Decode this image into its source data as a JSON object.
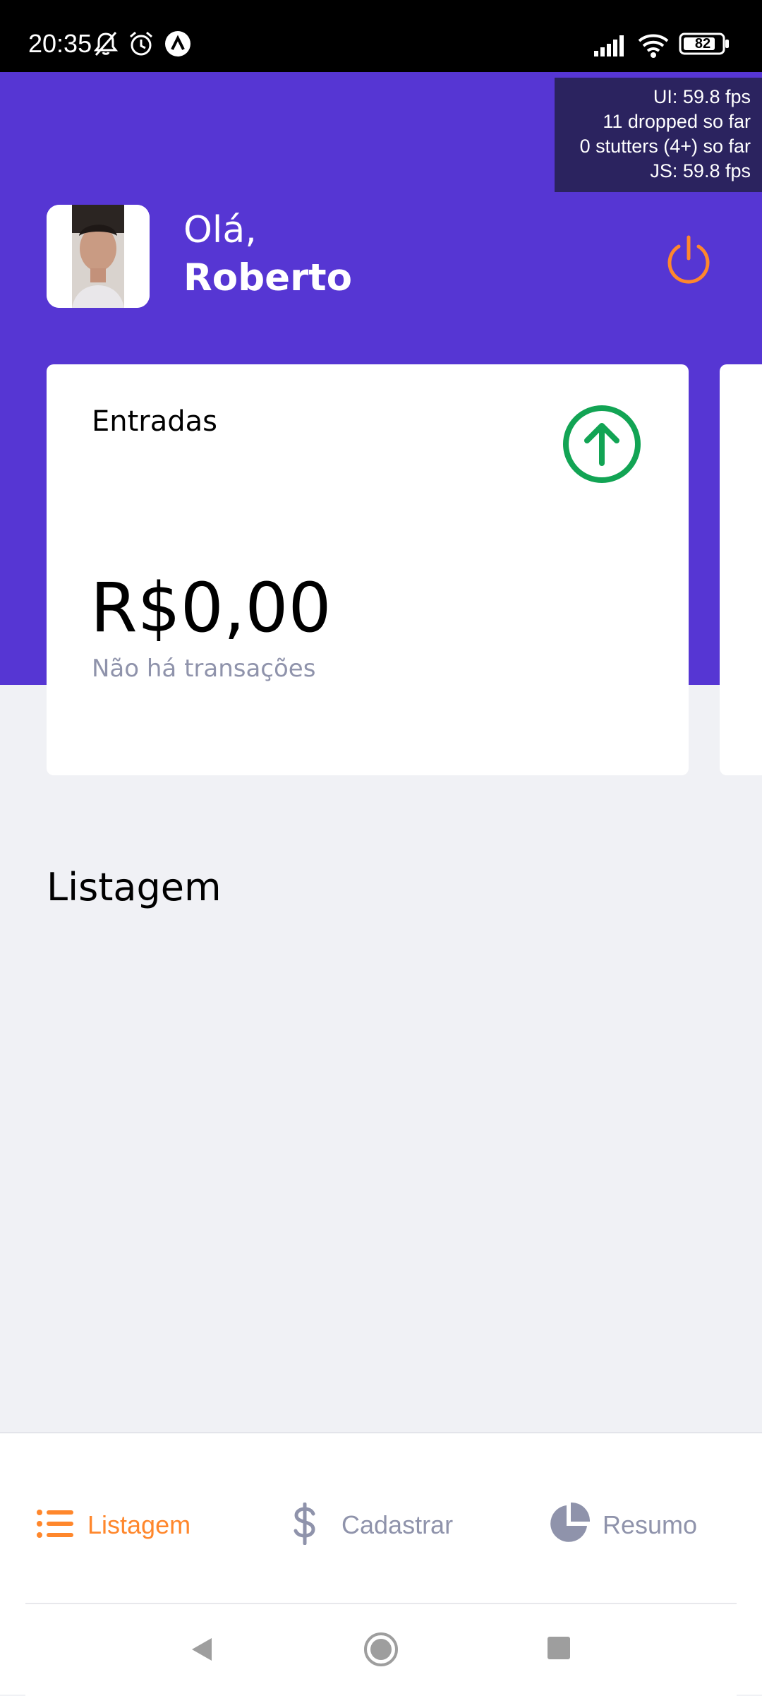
{
  "status_bar": {
    "time": "20:35",
    "battery": "82",
    "icons": [
      "mute-icon",
      "alarm-icon",
      "app-notification-icon",
      "signal-icon",
      "wifi-icon",
      "battery-icon"
    ]
  },
  "perf_monitor": {
    "ui_fps": "UI: 59.8 fps",
    "dropped": "11 dropped so far",
    "stutters": "0 stutters (4+) so far",
    "js_fps": "JS: 59.8 fps"
  },
  "header": {
    "greeting": "Olá,",
    "user_name": "Roberto",
    "logout_icon": "power-icon",
    "background_color": "#5636d3"
  },
  "summary_card": {
    "title": "Entradas",
    "amount": "R$0,00",
    "subtitle": "Não há transações",
    "icon": "arrow-up-circle-icon",
    "icon_color": "#12a454"
  },
  "listing": {
    "title": "Listagem"
  },
  "tab_bar": {
    "tabs": [
      {
        "label": "Listagem",
        "icon": "list-icon",
        "active": true
      },
      {
        "label": "Cadastrar",
        "icon": "dollar-icon",
        "active": false
      },
      {
        "label": "Resumo",
        "icon": "pie-chart-icon",
        "active": false
      }
    ],
    "active_color": "#ff872c",
    "inactive_color": "#8f93ab"
  },
  "nav_bar": {
    "buttons": [
      "back-icon",
      "home-icon",
      "recents-icon"
    ]
  }
}
